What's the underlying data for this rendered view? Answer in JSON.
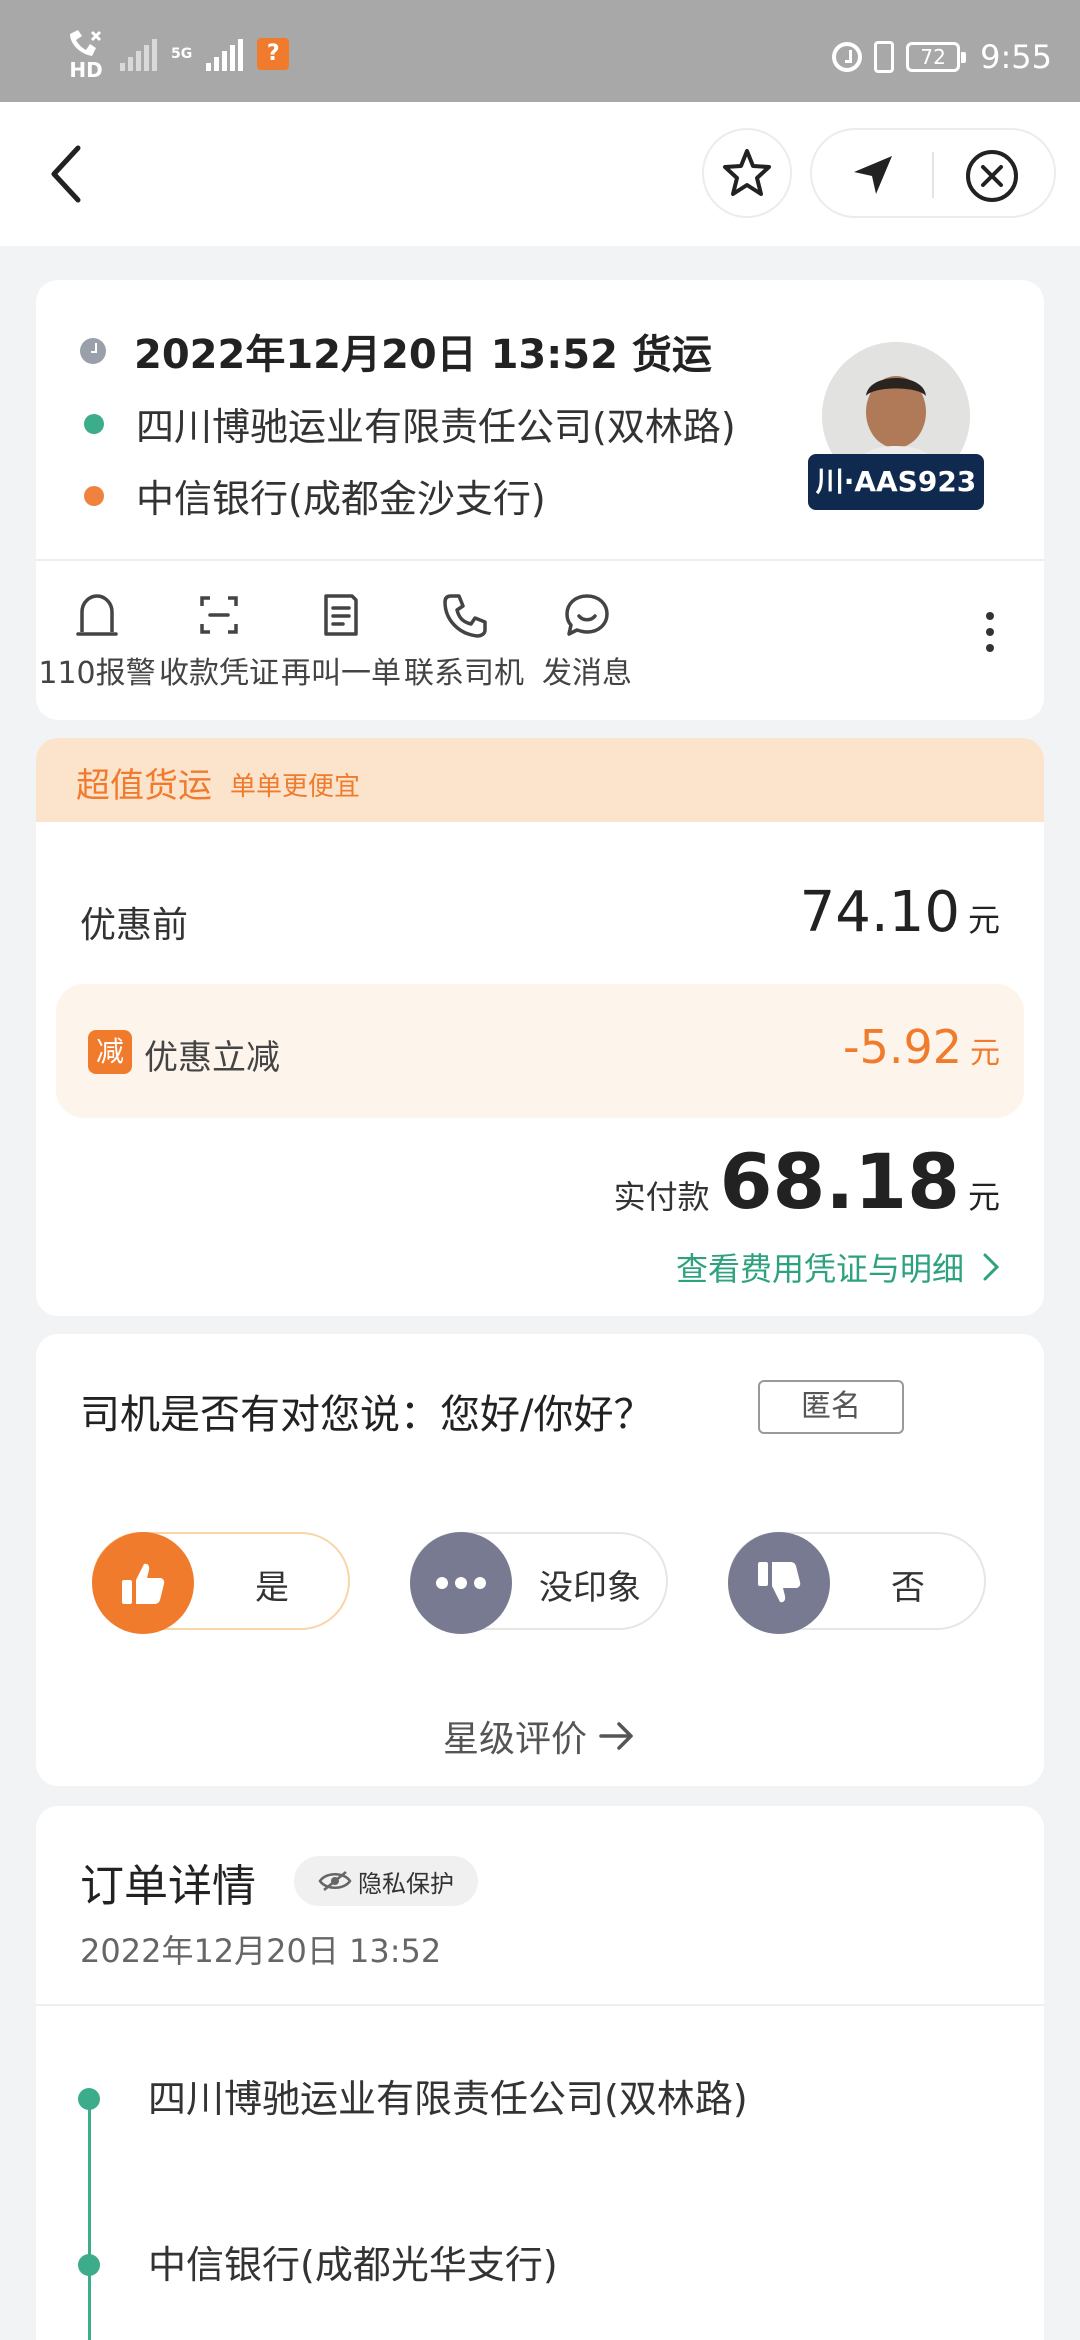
{
  "status_bar": {
    "signal_5g": "5G",
    "battery": "72",
    "time": "9:55"
  },
  "header": {
    "back_icon": "back-arrow-icon",
    "favorite_icon": "star-icon",
    "navigate_icon": "navigation-arrow-icon",
    "close_icon": "close-circle-icon"
  },
  "trip": {
    "datetime_type": "2022年12月20日 13:52 货运",
    "pickup": "四川博驰运业有限责任公司(双林路)",
    "dropoff": "中信银行(成都金沙支行)",
    "plate": "川·AAS923"
  },
  "actions": [
    {
      "label": "110报警",
      "icon": "alarm-bell-icon"
    },
    {
      "label": "收款凭证",
      "icon": "receipt-scan-icon"
    },
    {
      "label": "再叫一单",
      "icon": "reorder-note-icon"
    },
    {
      "label": "联系司机",
      "icon": "phone-icon"
    },
    {
      "label": "发消息",
      "icon": "message-bubble-icon"
    }
  ],
  "price": {
    "promo_title": "超值货运",
    "promo_subtitle": "单单更便宜",
    "pre_label": "优惠前",
    "pre_value": "74.10",
    "discount_badge": "减",
    "discount_label": "优惠立减",
    "discount_value": "-5.92",
    "paid_label": "实付款",
    "paid_value": "68.18",
    "currency": "元",
    "detail_link": "查看费用凭证与明细"
  },
  "question": {
    "title": "司机是否有对您说：您好/你好？",
    "anonymous": "匿名",
    "options": [
      "是",
      "没印象",
      "否"
    ],
    "star_rating": "星级评价"
  },
  "order": {
    "title": "订单详情",
    "privacy": "隐私保护",
    "datetime": "2022年12月20日 13:52",
    "stops": [
      "四川博驰运业有限责任公司(双林路)",
      "中信银行(成都光华支行)"
    ]
  },
  "colors": {
    "accent_orange": "#f07b2c",
    "accent_green": "#3dac8a",
    "plate_navy": "#0f2a4e"
  }
}
